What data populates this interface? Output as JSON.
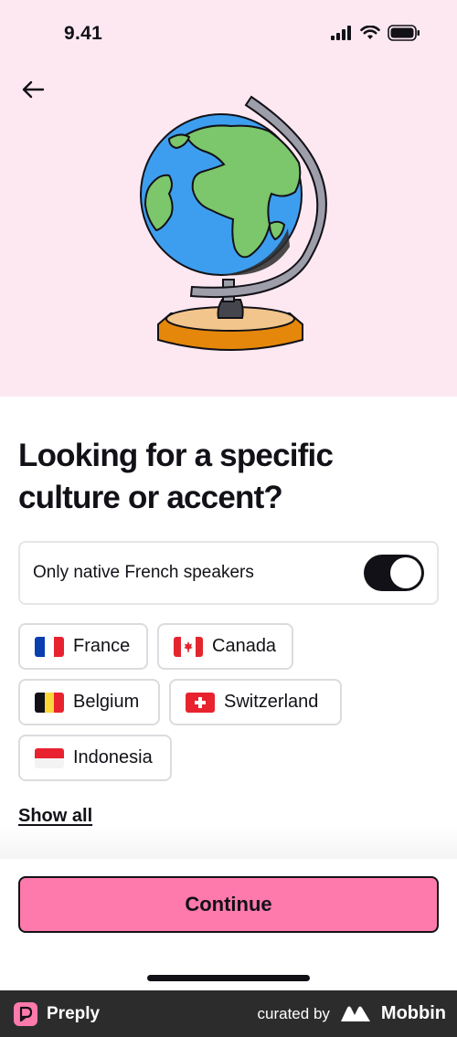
{
  "status_bar": {
    "time": "9.41"
  },
  "headline": "Looking for a specific culture or accent?",
  "native_toggle": {
    "label": "Only native French speakers",
    "enabled": true
  },
  "countries": [
    {
      "name": "France"
    },
    {
      "name": "Canada"
    },
    {
      "name": "Belgium"
    },
    {
      "name": "Switzerland"
    },
    {
      "name": "Indonesia"
    }
  ],
  "show_all_label": "Show all",
  "continue_label": "Continue",
  "footer": {
    "brand": "Preply",
    "curated_by": "curated by",
    "partner": "Mobbin"
  },
  "colors": {
    "hero_background": "#fde8f1",
    "accent_pink": "#ff7aac",
    "dark": "#121117",
    "footer_background": "#2c2c2c"
  },
  "icons": {
    "back": "arrow-left-icon",
    "signal": "cellular-signal-icon",
    "wifi": "wifi-icon",
    "battery": "battery-icon"
  }
}
